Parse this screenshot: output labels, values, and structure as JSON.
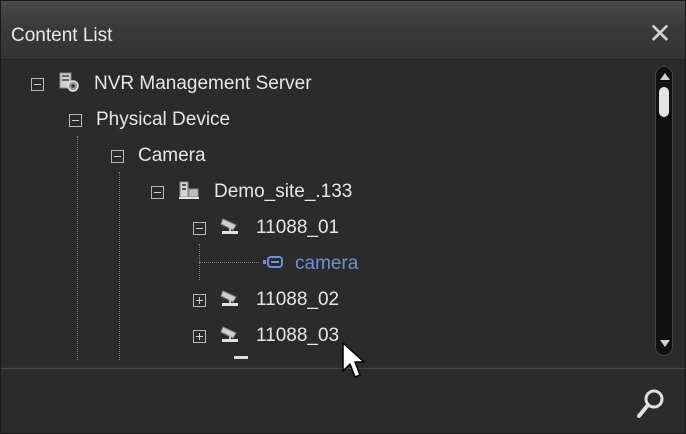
{
  "panel": {
    "title": "Content List",
    "close_symbol": "✕"
  },
  "tree": {
    "root": {
      "label": "NVR Management Server",
      "icon": "server-gear-icon",
      "expanded": true
    },
    "physical_device": {
      "label": "Physical Device",
      "expanded": true
    },
    "camera_group": {
      "label": "Camera",
      "expanded": true
    },
    "site": {
      "label": "Demo_site_.133",
      "icon": "nvr-building-icon",
      "expanded": true
    },
    "devices": [
      {
        "label": "11088_01",
        "icon": "cctv-camera-icon",
        "expanded": true
      },
      {
        "label": "11088_02",
        "icon": "cctv-camera-icon",
        "expanded": false
      },
      {
        "label": "11088_03",
        "icon": "cctv-camera-icon",
        "expanded": false
      }
    ],
    "channel": {
      "label": "camera",
      "icon": "camera-channel-icon",
      "color": "#6e8fd8"
    }
  },
  "footer": {
    "search_icon": "search-icon"
  }
}
